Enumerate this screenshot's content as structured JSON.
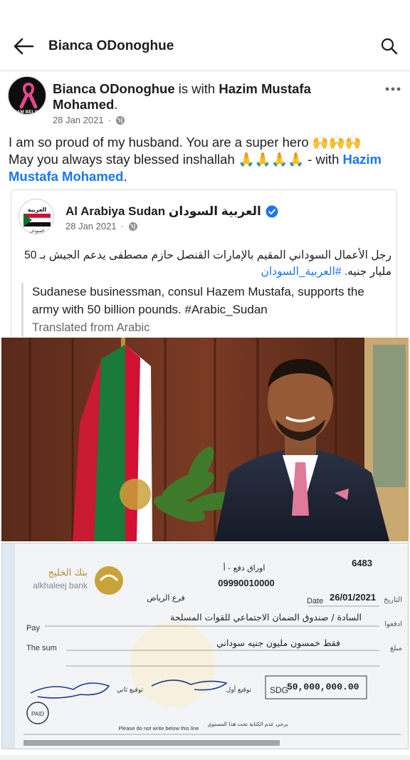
{
  "header": {
    "title": "Bianca ODonoghue"
  },
  "post": {
    "author": "Bianca ODonoghue",
    "with_text": "is with",
    "tagged": "Hazim Mustafa Mohamed",
    "date": "28 Jan 2021",
    "dot": "·",
    "text_line1": "I am so proud of my husband. You are a super hero 🙌🙌🙌",
    "text_line2": "May you always stay blessed inshallah 🙏🙏🙏🙏 - with",
    "text_link": "Hazim Mustafa Mohamed",
    "avatar_label": "TEAM BELINDA"
  },
  "shared": {
    "page_name": "Al Arabiya Sudan العربية السودان",
    "date": "28 Jan 2021",
    "dot": "·",
    "arabic_text": "رجل الأعمال السوداني المقيم بالإمارات القنصل حازم مصطفى يدعم الجيش بـ 50 مليار جنيه.",
    "arabic_tag": "#العربية_السودان",
    "translation": "Sudanese businessman, consul Hazem Mustafa, supports the army with 50 billion pounds. #Arabic_Sudan",
    "translated_label": "Translated from Arabic",
    "avatar_top": "العربية",
    "avatar_bottom": "السودان"
  },
  "cheque": {
    "bank_en": "alkhaleej bank",
    "bank_ar": "بنك الخليج",
    "number": "6483",
    "doc_type": "اوراق دفع - أ",
    "account": "09990010000",
    "branch": "فرع الرياض",
    "date_label": "Date",
    "date": "26/01/2021",
    "date_ar": "التاريخ",
    "pay_label": "Pay",
    "pay_ar": "ادفعوا",
    "payee": "السادة / صندوق الضمان الاجتماعي للقوات المسلحة",
    "sum_label": "The sum",
    "sum_ar": "مبلغ",
    "sum_words": "فقط خمسون مليون جنيه سوداني",
    "currency": "SDG",
    "amount": "50,000,000.00",
    "sig2_label": "توقيع ثاني",
    "sig1_label": "توقيع أول",
    "footer_en": "Please do not write below this line",
    "footer_ar": "يرجى عدم الكتابة تحت هذا المستوى",
    "paid_stamp": "PAID"
  },
  "colors": {
    "link": "#1877f2",
    "muted": "#65676b",
    "verified": "#1877f2"
  }
}
